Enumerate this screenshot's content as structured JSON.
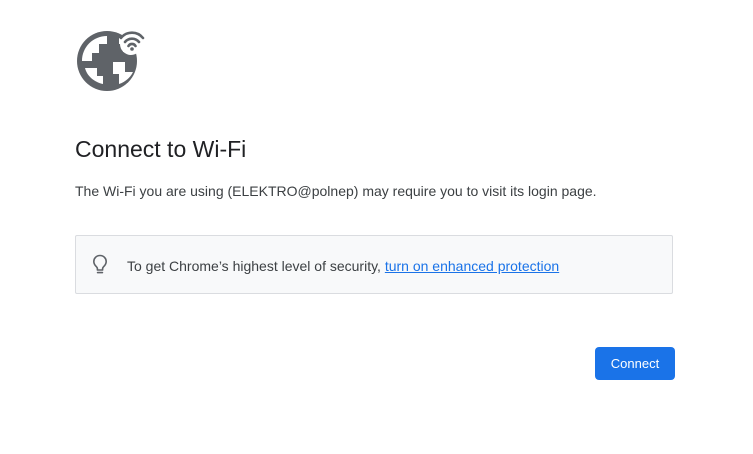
{
  "heading": {
    "title": "Connect to Wi-Fi"
  },
  "message": {
    "text": "The Wi-Fi you are using (ELEKTRO@polnep) may require you to visit its login page."
  },
  "tip": {
    "text": "To get Chrome’s highest level of security, ",
    "link_label": "turn on enhanced protection"
  },
  "actions": {
    "connect_label": "Connect"
  },
  "icons": {
    "logo": "globe-wifi-icon",
    "tip": "lightbulb-icon"
  },
  "colors": {
    "accent": "#1a73e8",
    "icon": "#5f6368",
    "tip_background": "#f8f9fa"
  }
}
